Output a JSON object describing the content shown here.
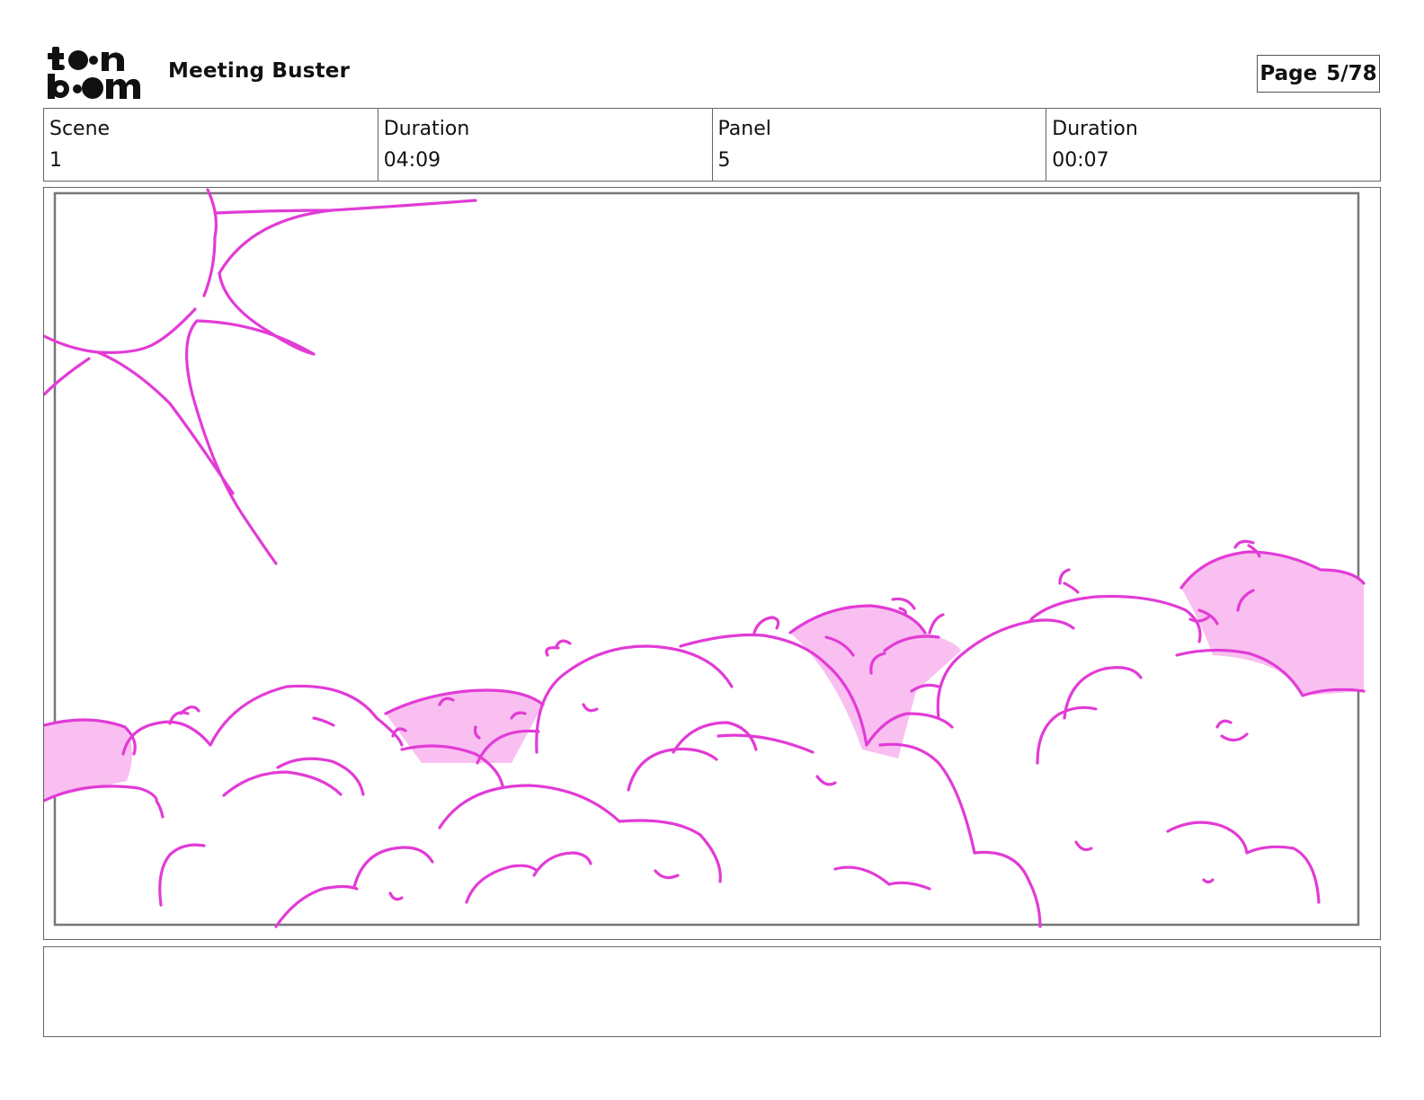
{
  "header": {
    "logo_label": "toon boom",
    "project_title": "Meeting Buster",
    "page_label": "Page",
    "page_value": "5/78"
  },
  "info": {
    "scene_label": "Scene",
    "scene_value": "1",
    "scene_duration_label": "Duration",
    "scene_duration_value": "04:09",
    "panel_label": "Panel",
    "panel_value": "5",
    "panel_duration_label": "Duration",
    "panel_duration_value": "00:07"
  },
  "panel": {
    "line_color": "#e23bd6",
    "fill_color": "#f9bff0",
    "frame_color": "#777777"
  },
  "notes": {
    "text": ""
  }
}
